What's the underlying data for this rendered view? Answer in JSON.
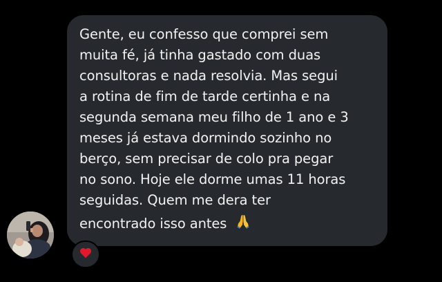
{
  "message": {
    "lines": [
      "Gente, eu confesso que comprei sem",
      "muita fé, já tinha gastado com duas",
      "consultoras e nada resolvia. Mas segui",
      "a rotina de fim de tarde certinha e na",
      "segunda semana meu filho de 1 ano e 3",
      "meses já estava dormindo sozinho no",
      "berço, sem precisar de colo pra pegar",
      "no sono. Hoje ele dorme umas 11 horas",
      "seguidas. Quem me dera ter",
      "encontrado isso antes"
    ],
    "trailing_emoji": "folded-hands-icon",
    "reaction": "red-heart-icon"
  },
  "sender": {
    "avatar": "avatar"
  },
  "colors": {
    "background": "#000000",
    "bubble": "#262a2f",
    "text": "#f2f2f2",
    "heart": "#e0192c"
  }
}
